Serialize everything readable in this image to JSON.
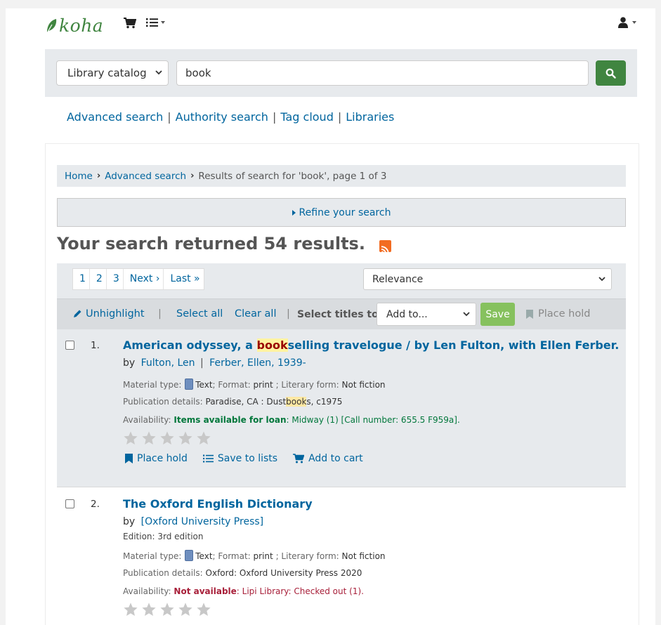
{
  "header": {
    "logo_text": "koha",
    "cart_icon": "cart-icon",
    "lists_icon": "lists-icon",
    "user_icon": "user-icon"
  },
  "search": {
    "scope_value": "Library catalog",
    "query": "book"
  },
  "module_links": [
    "Advanced search",
    "Authority search",
    "Tag cloud",
    "Libraries"
  ],
  "breadcrumb": {
    "home": "Home",
    "advanced": "Advanced search",
    "current": "Results of search for 'book', page 1 of 3"
  },
  "refine_label": "Refine your search",
  "results_heading": "Your search returned 54 results.",
  "pagination": [
    "1",
    "2",
    "3",
    "Next ›",
    "Last »"
  ],
  "sort_value": "Relevance",
  "select_bar": {
    "unhighlight": "Unhighlight",
    "select_all": "Select all",
    "clear_all": "Clear all",
    "select_titles_to": "Select titles to:",
    "add_to": "Add to...",
    "save": "Save",
    "place_hold": "Place hold"
  },
  "results": [
    {
      "number": "1.",
      "title_pre": "American odyssey, a ",
      "title_hl": "book",
      "title_post": "selling travelogue / by Len Fulton, with Ellen Ferber.",
      "by": "by",
      "authors": [
        "Fulton, Len",
        "Ferber, Ellen, 1939-"
      ],
      "material_label": "Material type:",
      "material_value": "Text",
      "format_label": "; Format:",
      "format_value": "print",
      "literary_label": "; Literary form:",
      "literary_value": "Not fiction",
      "pub_label": "Publication details:",
      "pub_pre": "Paradise, CA : Dust",
      "pub_hl": "book",
      "pub_post": "s, c1975",
      "avail_label": "Availability:",
      "avail_status": "Items available for loan",
      "avail_detail": ": Midway (1) [Call number: 655.5 F959a].",
      "actions": [
        "Place hold",
        "Save to lists",
        "Add to cart"
      ]
    },
    {
      "number": "2.",
      "title": "The Oxford English Dictionary",
      "by": "by",
      "authors": [
        "[Oxford University Press]"
      ],
      "edition": "Edition: 3rd edition",
      "material_label": "Material type:",
      "material_value": "Text",
      "format_label": "; Format:",
      "format_value": "print",
      "literary_label": "; Literary form:",
      "literary_value": "Not fiction",
      "pub_label": "Publication details:",
      "pub_value": "Oxford: Oxford University Press 2020",
      "avail_label": "Availability:",
      "avail_status": "Not available",
      "avail_detail": ": Lipi Library: Checked out (1)."
    }
  ],
  "colors": {
    "brand_green": "#408540",
    "link_blue": "#00659e",
    "save_green": "#86c15e",
    "rss_orange": "#f26c22"
  }
}
